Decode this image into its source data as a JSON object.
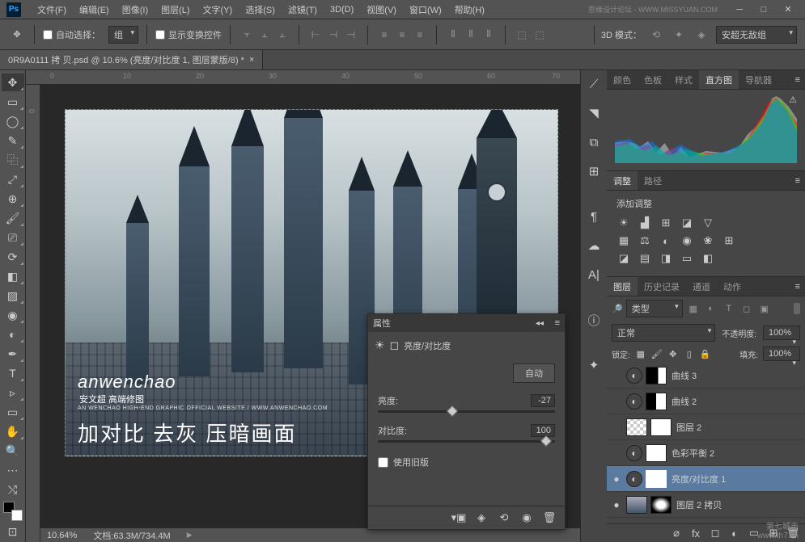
{
  "menubar": {
    "items": [
      "文件(F)",
      "编辑(E)",
      "图像(I)",
      "图层(L)",
      "文字(Y)",
      "选择(S)",
      "滤镜(T)",
      "3D(D)",
      "视图(V)",
      "窗口(W)",
      "帮助(H)"
    ],
    "watermark": "思缘设计论坛 - WWW.MISSYUAN.COM"
  },
  "options": {
    "auto_select": "自动选择：",
    "group": "组",
    "show_transform": "显示变换控件",
    "mode_3d": "3D 模式：",
    "preset_3d": "安超无敌组"
  },
  "doc_tab": "0R9A0111 拷 贝.psd @ 10.6% (亮度/对比度 1, 图层蒙版/8) *",
  "ruler_marks": [
    "0",
    "10",
    "20",
    "30",
    "40",
    "50",
    "60",
    "70"
  ],
  "ruler_v": [
    "0"
  ],
  "watermark": {
    "main": "anwenchao",
    "sub": "安文超 高端修图",
    "small": "AN WENCHAO HIGH-END GRAPHIC OFFICIAL WEBSITE / WWW.ANWENCHAO.COM"
  },
  "caption": "加对比 去灰 压暗画面",
  "status": {
    "zoom": "10.64%",
    "doc": "文档:63.3M/734.4M"
  },
  "panels": {
    "histogram_tabs": [
      "颜色",
      "色板",
      "样式",
      "直方图",
      "导航器"
    ],
    "adjust_tabs": [
      "调整",
      "路径"
    ],
    "adjust_title": "添加调整",
    "layer_tabs": [
      "图层",
      "历史记录",
      "通道",
      "动作"
    ],
    "filter_kind": "类型",
    "blend": "正常",
    "opacity_label": "不透明度:",
    "opacity": "100%",
    "lock_label": "锁定:",
    "fill_label": "填充:",
    "fill": "100%",
    "layers": [
      {
        "eye": "",
        "name": "曲线 3",
        "adj": true,
        "mask": "mask"
      },
      {
        "eye": "",
        "name": "曲线 2",
        "adj": true,
        "mask": "mask"
      },
      {
        "eye": "",
        "name": "图层 2",
        "adj": false,
        "mask": "white",
        "checker": true
      },
      {
        "eye": "",
        "name": "色彩平衡 2",
        "adj": true,
        "mask": "white"
      },
      {
        "eye": "●",
        "name": "亮度/对比度 1",
        "adj": true,
        "mask": "white",
        "selected": true
      },
      {
        "eye": "●",
        "name": "图层 2 拷贝",
        "adj": false,
        "mask": "mask",
        "img": true
      }
    ]
  },
  "properties": {
    "title": "属性",
    "subtitle": "亮度/对比度",
    "auto": "自动",
    "brightness_label": "亮度:",
    "brightness": "-27",
    "contrast_label": "对比度:",
    "contrast": "100",
    "legacy": "使用旧版"
  },
  "footer": "第七城市\nwww.th7.cn"
}
